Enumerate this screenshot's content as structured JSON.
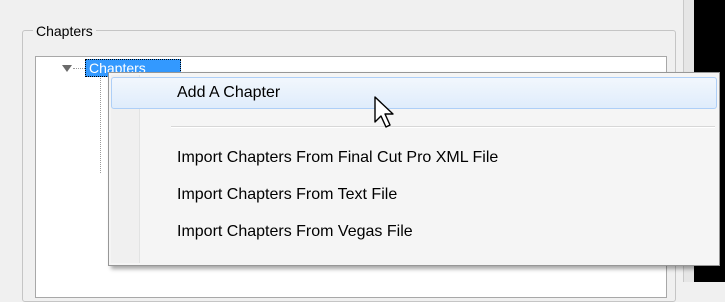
{
  "groupbox": {
    "title": "Chapters"
  },
  "tree": {
    "node_label": "Chapters"
  },
  "context_menu": {
    "items": [
      {
        "label": "Add A Chapter"
      },
      {
        "label": "Import Chapters From Final Cut Pro XML File"
      },
      {
        "label": "Import Chapters From Text File"
      },
      {
        "label": "Import Chapters From Vegas File"
      }
    ],
    "hover_index": 0
  },
  "colors": {
    "selection": "#3399ff",
    "menu_hover": "#dfecfb",
    "panel_dark": "#000000"
  },
  "icons": {
    "tree_expand": "triangle-down-icon",
    "cursor": "mouse-pointer-icon"
  }
}
